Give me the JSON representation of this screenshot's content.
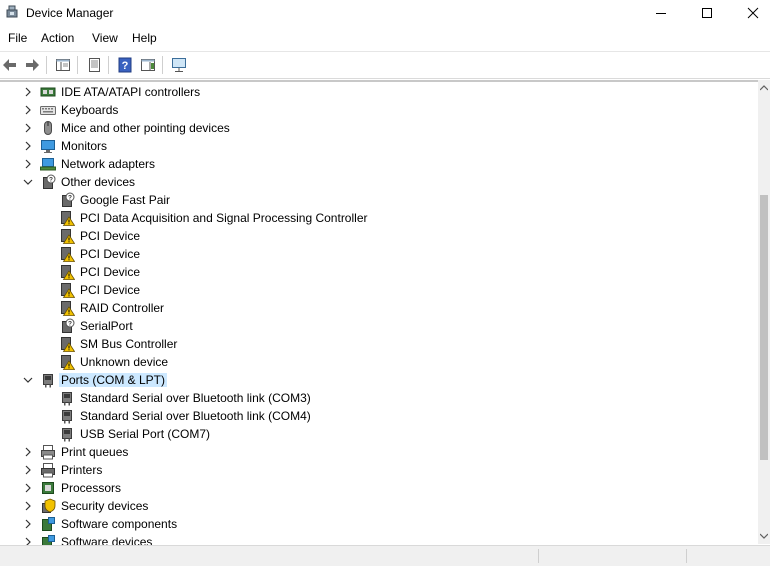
{
  "window": {
    "title": "Device Manager"
  },
  "menu": [
    "File",
    "Action",
    "View",
    "Help"
  ],
  "toolbar": {
    "buttons": [
      "back-icon",
      "forward-icon",
      "properties-pane-icon",
      "console-tree-icon",
      "help-icon",
      "show-hide-action-pane-icon",
      "scan-hardware-icon"
    ]
  },
  "tree": [
    {
      "label": "IDE ATA/ATAPI controllers",
      "level": 0,
      "expander": "collapsed",
      "icon": "ide-controller-icon"
    },
    {
      "label": "Keyboards",
      "level": 0,
      "expander": "collapsed",
      "icon": "keyboard-icon"
    },
    {
      "label": "Mice and other pointing devices",
      "level": 0,
      "expander": "collapsed",
      "icon": "mouse-icon"
    },
    {
      "label": "Monitors",
      "level": 0,
      "expander": "collapsed",
      "icon": "monitor-icon"
    },
    {
      "label": "Network adapters",
      "level": 0,
      "expander": "collapsed",
      "icon": "network-adapter-icon"
    },
    {
      "label": "Other devices",
      "level": 0,
      "expander": "expanded",
      "icon": "unknown-device-category-icon"
    },
    {
      "label": "Google Fast Pair",
      "level": 1,
      "icon": "unknown-device-icon"
    },
    {
      "label": "PCI Data Acquisition and Signal Processing Controller",
      "level": 1,
      "icon": "warning-device-icon"
    },
    {
      "label": "PCI Device",
      "level": 1,
      "icon": "warning-device-icon"
    },
    {
      "label": "PCI Device",
      "level": 1,
      "icon": "warning-device-icon"
    },
    {
      "label": "PCI Device",
      "level": 1,
      "icon": "warning-device-icon"
    },
    {
      "label": "PCI Device",
      "level": 1,
      "icon": "warning-device-icon"
    },
    {
      "label": "RAID Controller",
      "level": 1,
      "icon": "warning-device-icon"
    },
    {
      "label": "SerialPort",
      "level": 1,
      "icon": "unknown-device-icon"
    },
    {
      "label": "SM Bus Controller",
      "level": 1,
      "icon": "warning-device-icon"
    },
    {
      "label": "Unknown device",
      "level": 1,
      "icon": "warning-device-icon"
    },
    {
      "label": "Ports (COM & LPT)",
      "level": 0,
      "expander": "expanded",
      "icon": "port-icon",
      "selected": true
    },
    {
      "label": "Standard Serial over Bluetooth link (COM3)",
      "level": 1,
      "icon": "port-icon"
    },
    {
      "label": "Standard Serial over Bluetooth link (COM4)",
      "level": 1,
      "icon": "port-icon"
    },
    {
      "label": "USB Serial Port (COM7)",
      "level": 1,
      "icon": "port-icon"
    },
    {
      "label": "Print queues",
      "level": 0,
      "expander": "collapsed",
      "icon": "print-queue-icon"
    },
    {
      "label": "Printers",
      "level": 0,
      "expander": "collapsed",
      "icon": "printer-icon"
    },
    {
      "label": "Processors",
      "level": 0,
      "expander": "collapsed",
      "icon": "processor-icon"
    },
    {
      "label": "Security devices",
      "level": 0,
      "expander": "collapsed",
      "icon": "security-device-icon"
    },
    {
      "label": "Software components",
      "level": 0,
      "expander": "collapsed",
      "icon": "software-component-icon"
    },
    {
      "label": "Software devices",
      "level": 0,
      "expander": "collapsed",
      "icon": "software-device-icon"
    }
  ],
  "colors": {
    "selection": "#cce8ff",
    "warning": "#f2c200"
  }
}
